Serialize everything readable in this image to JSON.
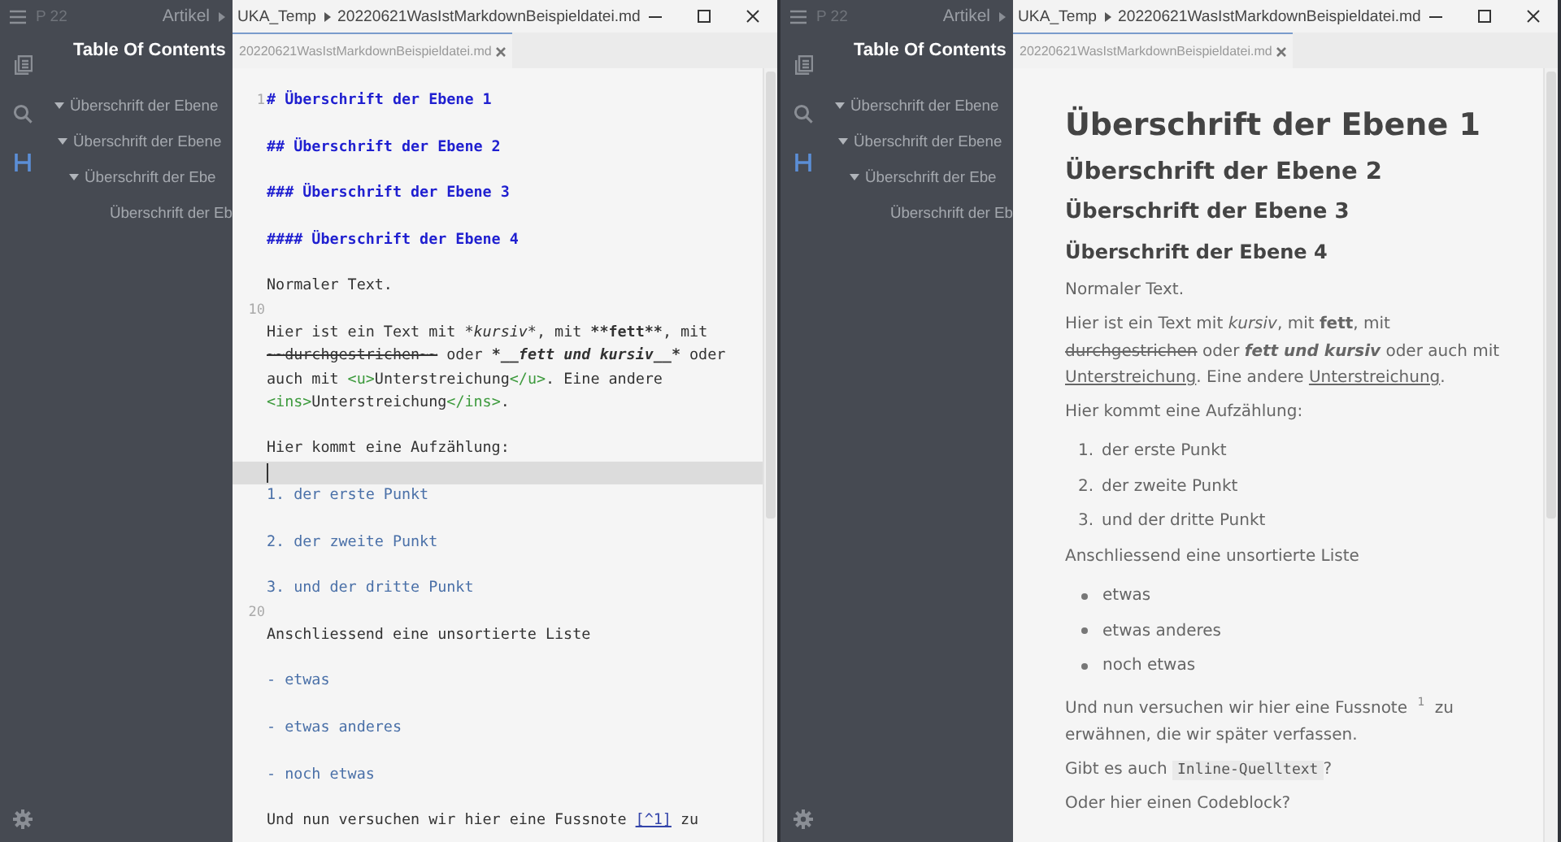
{
  "windows": [
    {
      "menu_label": "P 22",
      "breadcrumb": [
        "Artikel",
        "UKA_Temp",
        "20220621WasIstMarkdownBeispieldatei.md"
      ],
      "tabs": [
        {
          "label": "20220621WasIstMarkdownBeispieldatei.md",
          "selected": true
        }
      ],
      "toc": {
        "title": "Table Of Contents",
        "items": [
          {
            "label": "Überschrift der Ebene",
            "expanded": true,
            "children": [
              {
                "label": "Überschrift der Ebene",
                "expanded": true,
                "children": [
                  {
                    "label": "Überschrift der Ebe",
                    "expanded": true,
                    "children": [
                      {
                        "label": "Überschrift der Eb"
                      }
                    ]
                  }
                ]
              }
            ]
          }
        ]
      },
      "editor": {
        "kind": "source",
        "lines": [
          {
            "kind": "text",
            "number": "1",
            "current": false,
            "segments": [
              {
                "kind": "heading",
                "text": "# Überschrift der Ebene 1"
              }
            ]
          },
          {
            "kind": "blank",
            "current": false
          },
          {
            "kind": "text",
            "current": false,
            "segments": [
              {
                "kind": "heading",
                "text": "## Überschrift der Ebene 2"
              }
            ]
          },
          {
            "kind": "blank",
            "current": false
          },
          {
            "kind": "text",
            "current": false,
            "segments": [
              {
                "kind": "heading",
                "text": "### Überschrift der Ebene 3"
              }
            ]
          },
          {
            "kind": "blank",
            "current": false
          },
          {
            "kind": "text",
            "current": false,
            "segments": [
              {
                "kind": "heading",
                "text": "#### Überschrift der Ebene 4"
              }
            ]
          },
          {
            "kind": "blank",
            "current": false
          },
          {
            "kind": "text",
            "current": false,
            "segments": [
              {
                "kind": "plain",
                "text": "Normaler Text."
              }
            ]
          },
          {
            "kind": "blank",
            "number": "10",
            "current": false
          },
          {
            "kind": "text",
            "current": false,
            "segments": [
              {
                "kind": "plain",
                "text": "Hier ist ein Text mit "
              },
              {
                "kind": "italic",
                "text": "*kursiv*"
              },
              {
                "kind": "plain",
                "text": ", mit "
              },
              {
                "kind": "bold",
                "text": "**fett**"
              },
              {
                "kind": "plain",
                "text": ", mit"
              },
              {
                "kind": "break"
              },
              {
                "kind": "strike",
                "text": "~~durchgestrichen~~"
              },
              {
                "kind": "plain",
                "text": " oder "
              },
              {
                "kind": "bolditalic",
                "text": "*__fett und kursiv__*"
              },
              {
                "kind": "plain",
                "text": " oder"
              },
              {
                "kind": "break"
              },
              {
                "kind": "plain",
                "text": "auch mit "
              },
              {
                "kind": "tag",
                "text": "<u>"
              },
              {
                "kind": "plain",
                "text": "Unterstreichung"
              },
              {
                "kind": "tag",
                "text": "</u>"
              },
              {
                "kind": "plain",
                "text": ". Eine andere"
              },
              {
                "kind": "break"
              },
              {
                "kind": "tag",
                "text": "<ins>"
              },
              {
                "kind": "plain",
                "text": "Unterstreichung"
              },
              {
                "kind": "tag",
                "text": "</ins>"
              },
              {
                "kind": "plain",
                "text": "."
              }
            ]
          },
          {
            "kind": "blank",
            "current": false
          },
          {
            "kind": "text",
            "current": false,
            "segments": [
              {
                "kind": "plain",
                "text": "Hier kommt eine Aufzählung:"
              }
            ]
          },
          {
            "kind": "blank",
            "current": true
          },
          {
            "kind": "text",
            "current": false,
            "segments": [
              {
                "kind": "list",
                "text": "1. der erste Punkt"
              }
            ]
          },
          {
            "kind": "blank",
            "current": false
          },
          {
            "kind": "text",
            "current": false,
            "segments": [
              {
                "kind": "list",
                "text": "2. der zweite Punkt"
              }
            ]
          },
          {
            "kind": "blank",
            "current": false
          },
          {
            "kind": "text",
            "current": false,
            "segments": [
              {
                "kind": "list",
                "text": "3. und der dritte Punkt"
              }
            ]
          },
          {
            "kind": "blank",
            "number": "20",
            "current": false
          },
          {
            "kind": "text",
            "current": false,
            "segments": [
              {
                "kind": "plain",
                "text": "Anschliessend eine unsortierte Liste"
              }
            ]
          },
          {
            "kind": "blank",
            "current": false
          },
          {
            "kind": "text",
            "current": false,
            "segments": [
              {
                "kind": "list",
                "text": "- etwas"
              }
            ]
          },
          {
            "kind": "blank",
            "current": false
          },
          {
            "kind": "text",
            "current": false,
            "segments": [
              {
                "kind": "list",
                "text": "- etwas anderes"
              }
            ]
          },
          {
            "kind": "blank",
            "current": false
          },
          {
            "kind": "text",
            "current": false,
            "segments": [
              {
                "kind": "list",
                "text": "- noch etwas"
              }
            ]
          },
          {
            "kind": "blank",
            "current": false
          },
          {
            "kind": "text",
            "current": false,
            "segments": [
              {
                "kind": "plain",
                "text": "Und nun versuchen wir hier eine Fussnote "
              },
              {
                "kind": "link",
                "text": "[^1]"
              },
              {
                "kind": "plain",
                "text": " zu"
              }
            ]
          }
        ]
      }
    },
    {
      "menu_label": "P 22",
      "breadcrumb": [
        "Artikel",
        "UKA_Temp",
        "20220621WasIstMarkdownBeispieldatei.md"
      ],
      "tabs": [
        {
          "label": "20220621WasIstMarkdownBeispieldatei.md",
          "selected": true
        }
      ],
      "toc": {
        "title": "Table Of Contents",
        "items": [
          {
            "label": "Überschrift der Ebene",
            "expanded": true,
            "children": [
              {
                "label": "Überschrift der Ebene",
                "expanded": true,
                "children": [
                  {
                    "label": "Überschrift der Ebe",
                    "expanded": true,
                    "children": [
                      {
                        "label": "Überschrift der Eb"
                      }
                    ]
                  }
                ]
              }
            ]
          }
        ]
      },
      "editor": {
        "kind": "preview",
        "blocks": [
          {
            "kind": "h1",
            "text": "Überschrift der Ebene 1"
          },
          {
            "kind": "h2",
            "text": "Überschrift der Ebene 2"
          },
          {
            "kind": "h3",
            "text": "Überschrift der Ebene 3"
          },
          {
            "kind": "h4",
            "text": "Überschrift der Ebene 4"
          },
          {
            "kind": "p",
            "segments": [
              {
                "kind": "plain",
                "text": "Normaler Text."
              }
            ]
          },
          {
            "kind": "p",
            "segments": [
              {
                "kind": "plain",
                "text": "Hier ist ein Text mit "
              },
              {
                "kind": "italic",
                "text": "kursiv"
              },
              {
                "kind": "plain",
                "text": ", mit "
              },
              {
                "kind": "bold",
                "text": "fett"
              },
              {
                "kind": "plain",
                "text": ", mit"
              },
              {
                "kind": "break"
              },
              {
                "kind": "strike",
                "text": "durchgestrichen"
              },
              {
                "kind": "plain",
                "text": " oder "
              },
              {
                "kind": "bolditalic",
                "text": "fett und kursiv"
              },
              {
                "kind": "plain",
                "text": " oder auch mit"
              },
              {
                "kind": "break"
              },
              {
                "kind": "underline",
                "text": "Unterstreichung"
              },
              {
                "kind": "plain",
                "text": ". Eine andere "
              },
              {
                "kind": "underline",
                "text": "Unterstreichung"
              },
              {
                "kind": "plain",
                "text": "."
              }
            ]
          },
          {
            "kind": "p",
            "segments": [
              {
                "kind": "plain",
                "text": "Hier kommt eine Aufzählung:"
              }
            ]
          },
          {
            "kind": "ol",
            "items": [
              {
                "marker": "1.",
                "text": "der erste Punkt"
              },
              {
                "marker": "2.",
                "text": "der zweite Punkt"
              },
              {
                "marker": "3.",
                "text": "und der dritte Punkt"
              }
            ]
          },
          {
            "kind": "p",
            "segments": [
              {
                "kind": "plain",
                "text": "Anschliessend eine unsortierte Liste"
              }
            ]
          },
          {
            "kind": "ul",
            "items": [
              {
                "text": "etwas"
              },
              {
                "text": "etwas anderes"
              },
              {
                "text": "noch etwas"
              }
            ]
          },
          {
            "kind": "p",
            "segments": [
              {
                "kind": "plain",
                "text": "Und nun versuchen wir hier eine Fussnote "
              },
              {
                "kind": "footnote",
                "text": "1"
              },
              {
                "kind": "plain",
                "text": " zu"
              },
              {
                "kind": "break"
              },
              {
                "kind": "plain",
                "text": "erwähnen, die wir später verfassen."
              }
            ]
          },
          {
            "kind": "p",
            "segments": [
              {
                "kind": "plain",
                "text": "Gibt es auch "
              },
              {
                "kind": "code",
                "text": "Inline-Quelltext"
              },
              {
                "kind": "plain",
                "text": "?"
              }
            ]
          },
          {
            "kind": "p",
            "segments": [
              {
                "kind": "plain",
                "text": "Oder hier einen Codeblock?"
              }
            ]
          }
        ]
      }
    }
  ]
}
